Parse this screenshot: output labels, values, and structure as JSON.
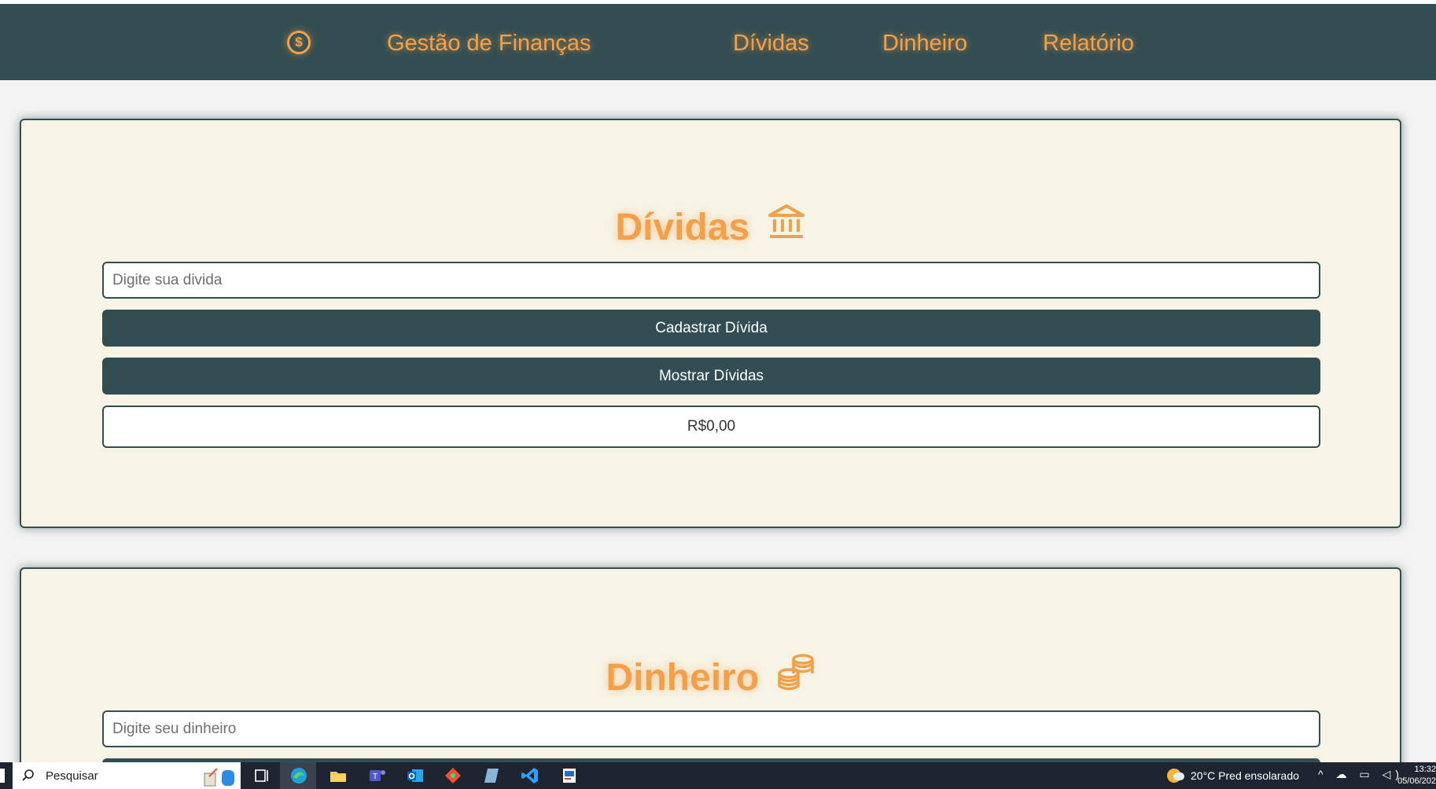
{
  "nav": {
    "logo_glyph": "$",
    "brand": "Gestão de Finanças",
    "links": [
      "Dívidas",
      "Dinheiro",
      "Relatório"
    ]
  },
  "dividas": {
    "title": "Dívidas",
    "title_icon": "bank-icon",
    "input_placeholder": "Digite sua divida",
    "input_value": "",
    "register_button": "Cadastrar Dívida",
    "show_button": "Mostrar Dívidas",
    "total": "R$0,00"
  },
  "dinheiro": {
    "title": "Dinheiro",
    "title_icon": "coins-icon",
    "input_placeholder": "Digite seu dinheiro",
    "input_value": ""
  },
  "taskbar": {
    "search_label": "Pesquisar",
    "weather": "20°C  Pred ensolarado",
    "time": "13:32",
    "date": "05/06/202"
  },
  "colors": {
    "navbar": "#324e52",
    "accent": "#f4a04a",
    "card_bg": "#f7f4e6",
    "page_bg": "#f3f3f3",
    "button": "#324e52"
  }
}
